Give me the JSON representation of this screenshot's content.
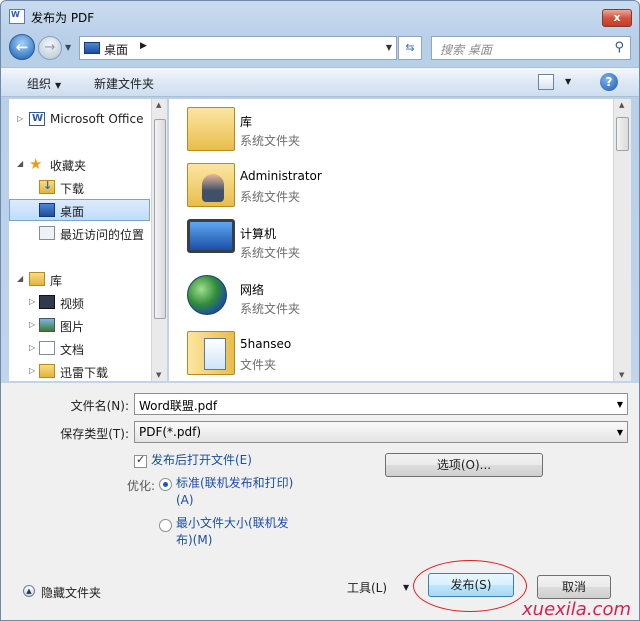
{
  "window": {
    "title": "发布为 PDF",
    "close": "x"
  },
  "nav": {
    "address_crumb": "桌面",
    "search_placeholder": "搜索 桌面"
  },
  "toolbar": {
    "organize": "组织",
    "new_folder": "新建文件夹"
  },
  "sidebar": {
    "items": [
      {
        "label": "Microsoft Office"
      },
      {
        "label": "收藏夹"
      },
      {
        "label": "下载"
      },
      {
        "label": "桌面"
      },
      {
        "label": "最近访问的位置"
      },
      {
        "label": "库"
      },
      {
        "label": "视频"
      },
      {
        "label": "图片"
      },
      {
        "label": "文档"
      },
      {
        "label": "迅雷下载"
      }
    ]
  },
  "files": [
    {
      "name": "库",
      "type": "系统文件夹"
    },
    {
      "name": "Administrator",
      "type": "系统文件夹"
    },
    {
      "name": "计算机",
      "type": "系统文件夹"
    },
    {
      "name": "网络",
      "type": "系统文件夹"
    },
    {
      "name": "5hanseo",
      "type": "文件夹"
    }
  ],
  "form": {
    "filename_label": "文件名(N):",
    "filename_value": "Word联盟.pdf",
    "savetype_label": "保存类型(T):",
    "savetype_value": "PDF(*.pdf)",
    "open_after_label": "发布后打开文件(E)",
    "optimize_label": "优化:",
    "opt_standard_line1": "标准(联机发布和打印)",
    "opt_standard_line2": "(A)",
    "opt_min_line1": "最小文件大小(联机发",
    "opt_min_line2": "布)(M)",
    "options_button": "选项(O)..."
  },
  "footer": {
    "hide_folders": "隐藏文件夹",
    "tools": "工具(L)",
    "publish": "发布(S)",
    "cancel": "取消"
  },
  "watermark": "xuexila.com"
}
